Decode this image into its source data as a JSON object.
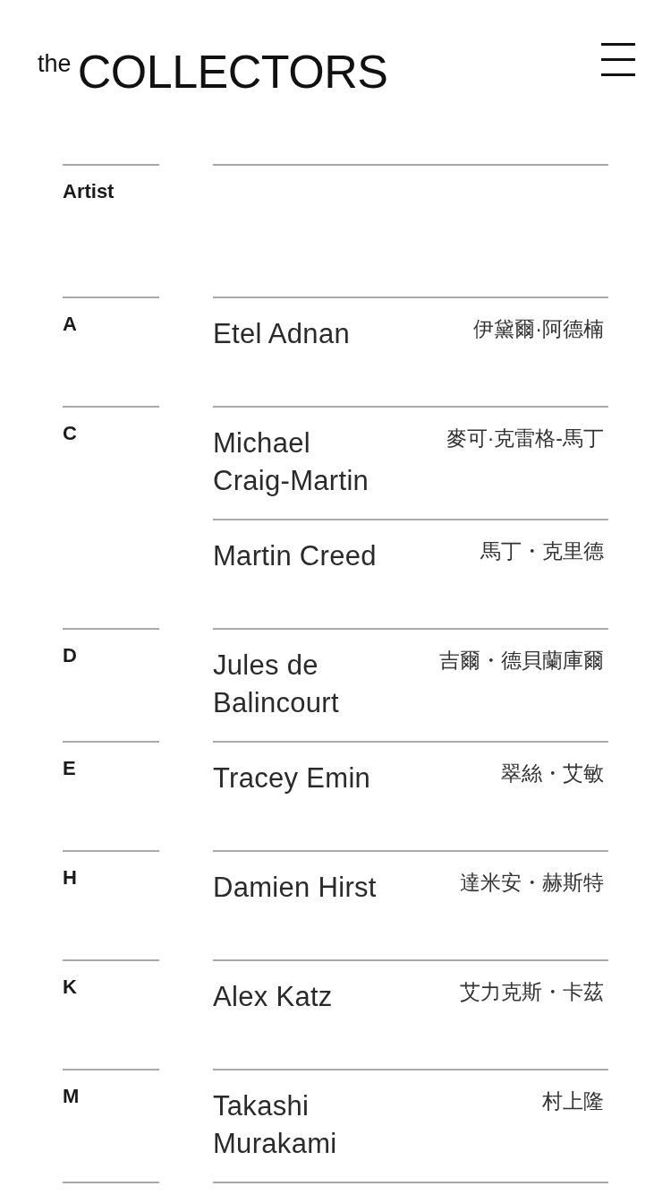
{
  "header": {
    "logo": {
      "prefix": "the",
      "wordmark": "COLLECTORS"
    }
  },
  "index": {
    "heading": "Artist",
    "groups": [
      {
        "letter": "A",
        "artists": [
          {
            "name": "Etel Adnan",
            "chinese_name": "伊黛爾·阿德楠"
          }
        ]
      },
      {
        "letter": "C",
        "artists": [
          {
            "name": "Michael Craig-Martin",
            "chinese_name": "麥可·克雷格-馬丁"
          },
          {
            "name": "Martin Creed",
            "chinese_name": "馬丁・克里德"
          }
        ]
      },
      {
        "letter": "D",
        "artists": [
          {
            "name": "Jules de Balincourt",
            "chinese_name": "吉爾・德貝蘭庫爾"
          }
        ]
      },
      {
        "letter": "E",
        "artists": [
          {
            "name": "Tracey Emin",
            "chinese_name": "翠絲・艾敏"
          }
        ]
      },
      {
        "letter": "H",
        "artists": [
          {
            "name": "Damien Hirst",
            "chinese_name": "達米安・赫斯特"
          }
        ]
      },
      {
        "letter": "K",
        "artists": [
          {
            "name": "Alex Katz",
            "chinese_name": "艾力克斯・卡茲"
          }
        ]
      },
      {
        "letter": "M",
        "artists": [
          {
            "name": "Takashi Murakami",
            "chinese_name": "村上隆"
          }
        ]
      }
    ]
  }
}
